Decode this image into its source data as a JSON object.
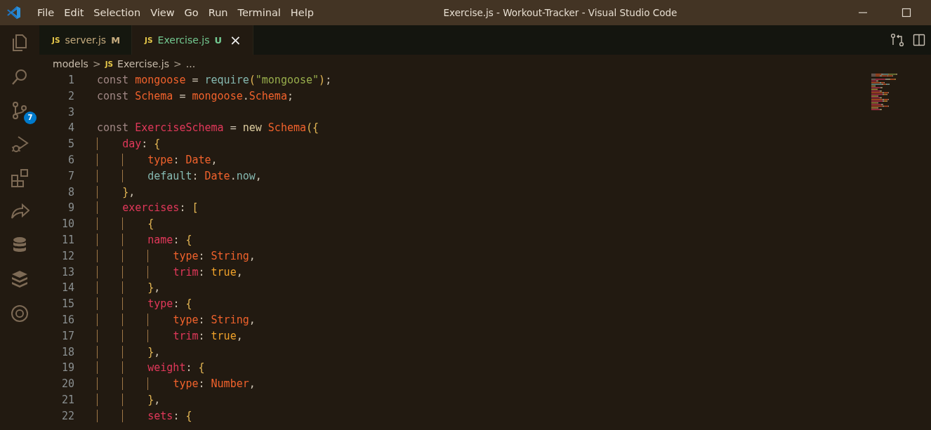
{
  "window": {
    "title": "Exercise.js - Workout-Tracker - Visual Studio Code"
  },
  "menu": [
    "File",
    "Edit",
    "Selection",
    "View",
    "Go",
    "Run",
    "Terminal",
    "Help"
  ],
  "activity_bar": [
    {
      "kind": "files"
    },
    {
      "kind": "search"
    },
    {
      "kind": "source-control",
      "badge": "7"
    },
    {
      "kind": "debug"
    },
    {
      "kind": "extensions"
    },
    {
      "kind": "share"
    },
    {
      "kind": "database"
    },
    {
      "kind": "layers"
    },
    {
      "kind": "target"
    }
  ],
  "tabs": [
    {
      "icon_text": "JS",
      "label": "server.js",
      "status": "M",
      "color": "#c5ab7e",
      "selected": false
    },
    {
      "icon_text": "JS",
      "label": "Exercise.js",
      "status": "U",
      "color": "#73c991",
      "selected": true,
      "close": "×"
    }
  ],
  "breadcrumbs": [
    {
      "kind": "folder",
      "text": "models"
    },
    {
      "kind": "sep",
      "text": ">"
    },
    {
      "kind": "file",
      "icon_text": "JS",
      "text": "Exercise.js"
    },
    {
      "kind": "sep",
      "text": ">"
    },
    {
      "kind": "more",
      "text": "..."
    }
  ],
  "code_lines": [
    {
      "number": "1",
      "tokens": [
        {
          "kind": "kw",
          "text": "const "
        },
        {
          "kind": "var",
          "text": "mongoose"
        },
        {
          "kind": "op",
          "text": " = "
        },
        {
          "kind": "fn",
          "text": "require"
        },
        {
          "kind": "brace",
          "text": "("
        },
        {
          "kind": "str",
          "text": "\"mongoose\""
        },
        {
          "kind": "brace",
          "text": ")"
        },
        {
          "kind": "op",
          "text": ";"
        }
      ]
    },
    {
      "number": "2",
      "tokens": [
        {
          "kind": "kw",
          "text": "const "
        },
        {
          "kind": "var",
          "text": "Schema"
        },
        {
          "kind": "op",
          "text": " = "
        },
        {
          "kind": "var",
          "text": "mongoose"
        },
        {
          "kind": "op",
          "text": "."
        },
        {
          "kind": "var",
          "text": "Schema"
        },
        {
          "kind": "op",
          "text": ";"
        }
      ]
    },
    {
      "number": "3"
    },
    {
      "number": "4",
      "tokens": [
        {
          "kind": "kw",
          "text": "const "
        },
        {
          "kind": "prop",
          "text": "ExerciseSchema"
        },
        {
          "kind": "op",
          "text": " = "
        },
        {
          "kind": "new",
          "text": "new "
        },
        {
          "kind": "var",
          "text": "Schema"
        },
        {
          "kind": "brace",
          "text": "({"
        }
      ]
    },
    {
      "number": "5",
      "tokens": [
        {
          "kind": "prop",
          "text": "    day"
        },
        {
          "kind": "op",
          "text": ": "
        },
        {
          "kind": "brace",
          "text": "{"
        }
      ]
    },
    {
      "number": "6",
      "tokens": [
        {
          "kind": "var",
          "text": "        type"
        },
        {
          "kind": "op",
          "text": ": "
        },
        {
          "kind": "var",
          "text": "Date"
        },
        {
          "kind": "op",
          "text": ","
        }
      ]
    },
    {
      "number": "7",
      "tokens": [
        {
          "kind": "fn",
          "text": "        default"
        },
        {
          "kind": "op",
          "text": ": "
        },
        {
          "kind": "var",
          "text": "Date"
        },
        {
          "kind": "op",
          "text": "."
        },
        {
          "kind": "fn",
          "text": "now"
        },
        {
          "kind": "op",
          "text": ","
        }
      ]
    },
    {
      "number": "8",
      "tokens": [
        {
          "kind": "brace",
          "text": "    }"
        },
        {
          "kind": "op",
          "text": ","
        }
      ]
    },
    {
      "number": "9",
      "tokens": [
        {
          "kind": "prop",
          "text": "    exercises"
        },
        {
          "kind": "op",
          "text": ": "
        },
        {
          "kind": "brace",
          "text": "["
        }
      ]
    },
    {
      "number": "10",
      "tokens": [
        {
          "kind": "brace",
          "text": "        {"
        }
      ]
    },
    {
      "number": "11",
      "tokens": [
        {
          "kind": "prop",
          "text": "        name"
        },
        {
          "kind": "op",
          "text": ": "
        },
        {
          "kind": "brace",
          "text": "{"
        }
      ]
    },
    {
      "number": "12",
      "tokens": [
        {
          "kind": "var",
          "text": "            type"
        },
        {
          "kind": "op",
          "text": ": "
        },
        {
          "kind": "var",
          "text": "String"
        },
        {
          "kind": "op",
          "text": ","
        }
      ]
    },
    {
      "number": "13",
      "tokens": [
        {
          "kind": "prop",
          "text": "            trim"
        },
        {
          "kind": "op",
          "text": ": "
        },
        {
          "kind": "bool",
          "text": "true"
        },
        {
          "kind": "op",
          "text": ","
        }
      ]
    },
    {
      "number": "14",
      "tokens": [
        {
          "kind": "brace",
          "text": "        }"
        },
        {
          "kind": "op",
          "text": ","
        }
      ]
    },
    {
      "number": "15",
      "tokens": [
        {
          "kind": "prop",
          "text": "        type"
        },
        {
          "kind": "op",
          "text": ": "
        },
        {
          "kind": "brace",
          "text": "{"
        }
      ]
    },
    {
      "number": "16",
      "tokens": [
        {
          "kind": "var",
          "text": "            type"
        },
        {
          "kind": "op",
          "text": ": "
        },
        {
          "kind": "var",
          "text": "String"
        },
        {
          "kind": "op",
          "text": ","
        }
      ]
    },
    {
      "number": "17",
      "tokens": [
        {
          "kind": "prop",
          "text": "            trim"
        },
        {
          "kind": "op",
          "text": ": "
        },
        {
          "kind": "bool",
          "text": "true"
        },
        {
          "kind": "op",
          "text": ","
        }
      ]
    },
    {
      "number": "18",
      "tokens": [
        {
          "kind": "brace",
          "text": "        }"
        },
        {
          "kind": "op",
          "text": ","
        }
      ]
    },
    {
      "number": "19",
      "tokens": [
        {
          "kind": "prop",
          "text": "        weight"
        },
        {
          "kind": "op",
          "text": ": "
        },
        {
          "kind": "brace",
          "text": "{"
        }
      ]
    },
    {
      "number": "20",
      "tokens": [
        {
          "kind": "var",
          "text": "            type"
        },
        {
          "kind": "op",
          "text": ": "
        },
        {
          "kind": "var",
          "text": "Number"
        },
        {
          "kind": "op",
          "text": ","
        }
      ]
    },
    {
      "number": "21",
      "tokens": [
        {
          "kind": "brace",
          "text": "        }"
        },
        {
          "kind": "op",
          "text": ","
        }
      ]
    },
    {
      "number": "22",
      "tokens": [
        {
          "kind": "prop",
          "text": "        sets"
        },
        {
          "kind": "op",
          "text": ": "
        },
        {
          "kind": "brace",
          "text": "{"
        }
      ]
    }
  ]
}
